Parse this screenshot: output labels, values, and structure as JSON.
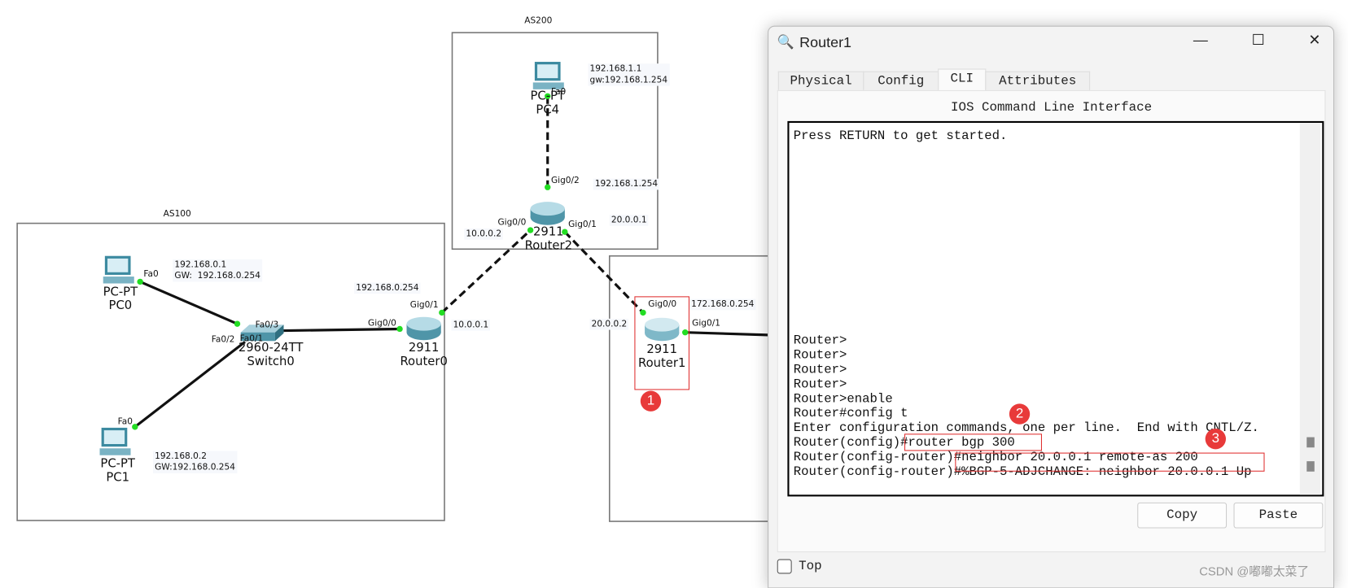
{
  "topology": {
    "areas": [
      {
        "label": "AS100"
      },
      {
        "label": "AS200"
      }
    ],
    "devices": {
      "pc0": {
        "model": "PC-PT",
        "name": "PC0",
        "note": "192.168.0.1\nGW:  192.168.0.254",
        "port": "Fa0"
      },
      "pc1": {
        "model": "PC-PT",
        "name": "PC1",
        "note": "192.168.0.2\nGW:192.168.0.254",
        "port": "Fa0"
      },
      "pc4": {
        "model": "PC-PT",
        "name": "PC4",
        "note": "192.168.1.1\ngw:192.168.1.254",
        "port": "Fa0"
      },
      "switch0": {
        "model": "2960-24TT",
        "name": "Switch0",
        "ports": [
          "Fa0/1",
          "Fa0/2",
          "Fa0/3"
        ]
      },
      "router0": {
        "model": "2911",
        "name": "Router0",
        "ports": [
          "Gig0/0",
          "Gig0/1"
        ],
        "notes": [
          "192.168.0.254",
          "10.0.0.1"
        ]
      },
      "router2": {
        "model": "2911",
        "name": "Router2",
        "ports": [
          "Gig0/0",
          "Gig0/1",
          "Gig0/2"
        ],
        "notes": [
          "10.0.0.2",
          "20.0.0.1",
          "192.168.1.254"
        ]
      },
      "router1": {
        "model": "2911",
        "name": "Router1",
        "ports": [
          "Gig0/0",
          "Gig0/1"
        ],
        "notes": [
          "20.0.0.2",
          "172.168.0.254"
        ]
      }
    },
    "annotations": [
      "1",
      "2",
      "3"
    ],
    "colors": {
      "port_up": "#22dd22",
      "annotation": "#e83a3a"
    }
  },
  "window": {
    "title": "Router1",
    "controls": {
      "minimize": "—",
      "maximize": "☐",
      "close": "✕"
    },
    "tabs": [
      {
        "label": "Physical"
      },
      {
        "label": "Config"
      },
      {
        "label": "CLI",
        "active": true
      },
      {
        "label": "Attributes"
      }
    ],
    "cli_title": "IOS Command Line Interface",
    "terminal_top": "Press RETURN to get started.",
    "terminal_lines": [
      "Router>",
      "Router>",
      "Router>",
      "Router>",
      "Router>enable",
      "Router#config t",
      "Enter configuration commands, one per line.  End with CNTL/Z.",
      "Router(config)#router bgp 300",
      "Router(config-router)#neighbor 20.0.0.1 remote-as 200",
      "Router(config-router)#%BGP-5-ADJCHANGE: neighbor 20.0.0.1 Up"
    ],
    "copy_label": "Copy",
    "paste_label": "Paste",
    "top_label": "Top",
    "top_checked": false
  },
  "watermark": "CSDN @嘟嘟太菜了"
}
